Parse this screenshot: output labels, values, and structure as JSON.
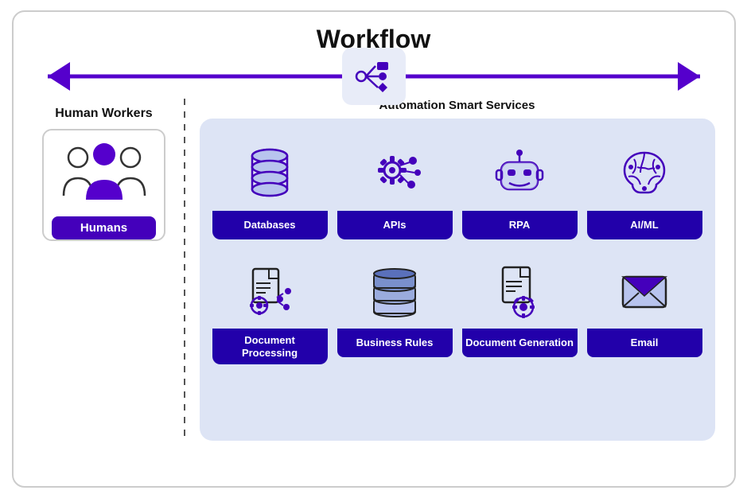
{
  "page": {
    "title": "Workflow",
    "arrow": {
      "direction": "bidirectional"
    },
    "left_panel": {
      "heading": "Human Workers",
      "card_label": "Humans"
    },
    "automation": {
      "heading": "Automation Smart Services",
      "services": [
        {
          "id": "databases",
          "label": "Databases",
          "icon": "database-icon"
        },
        {
          "id": "apis",
          "label": "APIs",
          "icon": "api-icon"
        },
        {
          "id": "rpa",
          "label": "RPA",
          "icon": "robot-icon"
        },
        {
          "id": "aiml",
          "label": "AI/ML",
          "icon": "brain-icon"
        },
        {
          "id": "doc-processing",
          "label": "Document\nProcessing",
          "icon": "doc-processing-icon"
        },
        {
          "id": "business-rules",
          "label": "Business Rules",
          "icon": "books-icon"
        },
        {
          "id": "doc-generation",
          "label": "Document\nGeneration",
          "icon": "doc-generation-icon"
        },
        {
          "id": "email",
          "label": "Email",
          "icon": "email-icon"
        }
      ]
    }
  }
}
